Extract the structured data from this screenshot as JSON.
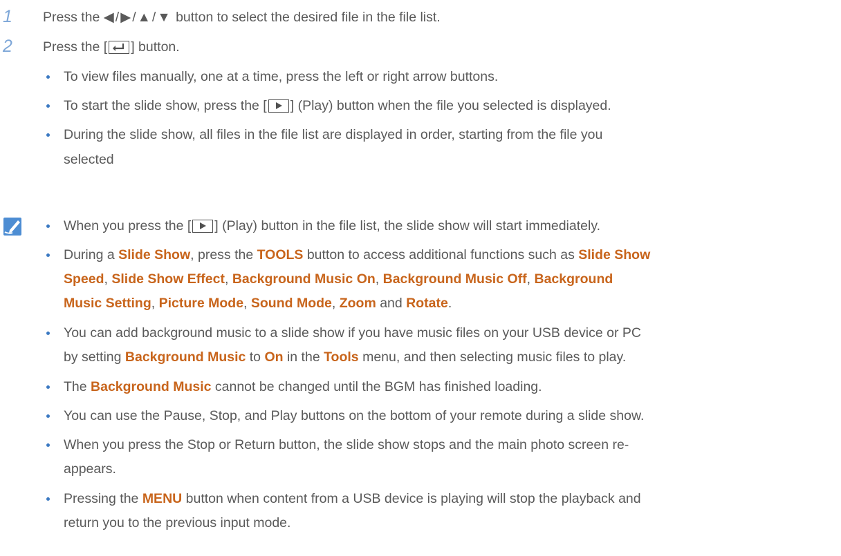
{
  "steps": [
    {
      "num": "1",
      "pre": "Press the ",
      "arrows": "◀/▶/▲/▼",
      "post": " button to select the desired file in the file list."
    },
    {
      "num": "2",
      "pre": "Press the [",
      "post": "] button."
    }
  ],
  "step2_bullets": {
    "b1": "To view files manually, one at a time, press the left or right arrow buttons.",
    "b2_pre": "To start the slide show, press the [",
    "b2_post": "] (Play) button when the file you selected is displayed.",
    "b3_line1": "During the slide show, all files in the file list are displayed in order, starting from the file you",
    "b3_line2": "selected"
  },
  "notes": {
    "n1_pre": "When you press the [",
    "n1_post": "] (Play) button in the file list, the slide show will start immediately.",
    "n2": {
      "t1": "During a ",
      "h1": "Slide Show",
      "t2": ", press the ",
      "h2": "TOOLS",
      "t3": " button to access additional functions such as ",
      "h3": "Slide Show",
      "h4": "Speed",
      "t4": ", ",
      "h5": "Slide Show Effect",
      "t5": ", ",
      "h6": "Background Music On",
      "t6": ", ",
      "h7": "Background Music Off",
      "t7": ", ",
      "h8": "Background",
      "h9": "Music Setting",
      "t8": ", ",
      "h10": "Picture Mode",
      "t9": ", ",
      "h11": "Sound Mode",
      "t10": ", ",
      "h12": "Zoom",
      "t11": " and ",
      "h13": "Rotate",
      "t12": "."
    },
    "n3": {
      "line1": "You can add background music to a slide show if you have music files on your USB device or PC",
      "t1": "by setting ",
      "h1": "Background Music",
      "t2": " to ",
      "h2": "On",
      "t3": " in the ",
      "h3": "Tools",
      "t4": " menu, and then selecting music files to play."
    },
    "n4": {
      "t1": "The ",
      "h1": "Background Music",
      "t2": " cannot be changed until the BGM has finished loading."
    },
    "n5": "You can use the Pause, Stop, and Play buttons on the bottom of your remote during a slide show.",
    "n6_line1": "When you press the Stop or Return button, the slide show stops and the main photo screen re-",
    "n6_line2": "appears.",
    "n7": {
      "t1": "Pressing the ",
      "h1": "MENU",
      "t2": " button when content from a USB device is playing will stop the playback and",
      "line2": "return you to the previous input mode."
    }
  },
  "colors": {
    "accent": "#c8651c",
    "step_number": "#7ea7d8",
    "bullet": "#3b79c2",
    "text": "#5a5a5a"
  }
}
